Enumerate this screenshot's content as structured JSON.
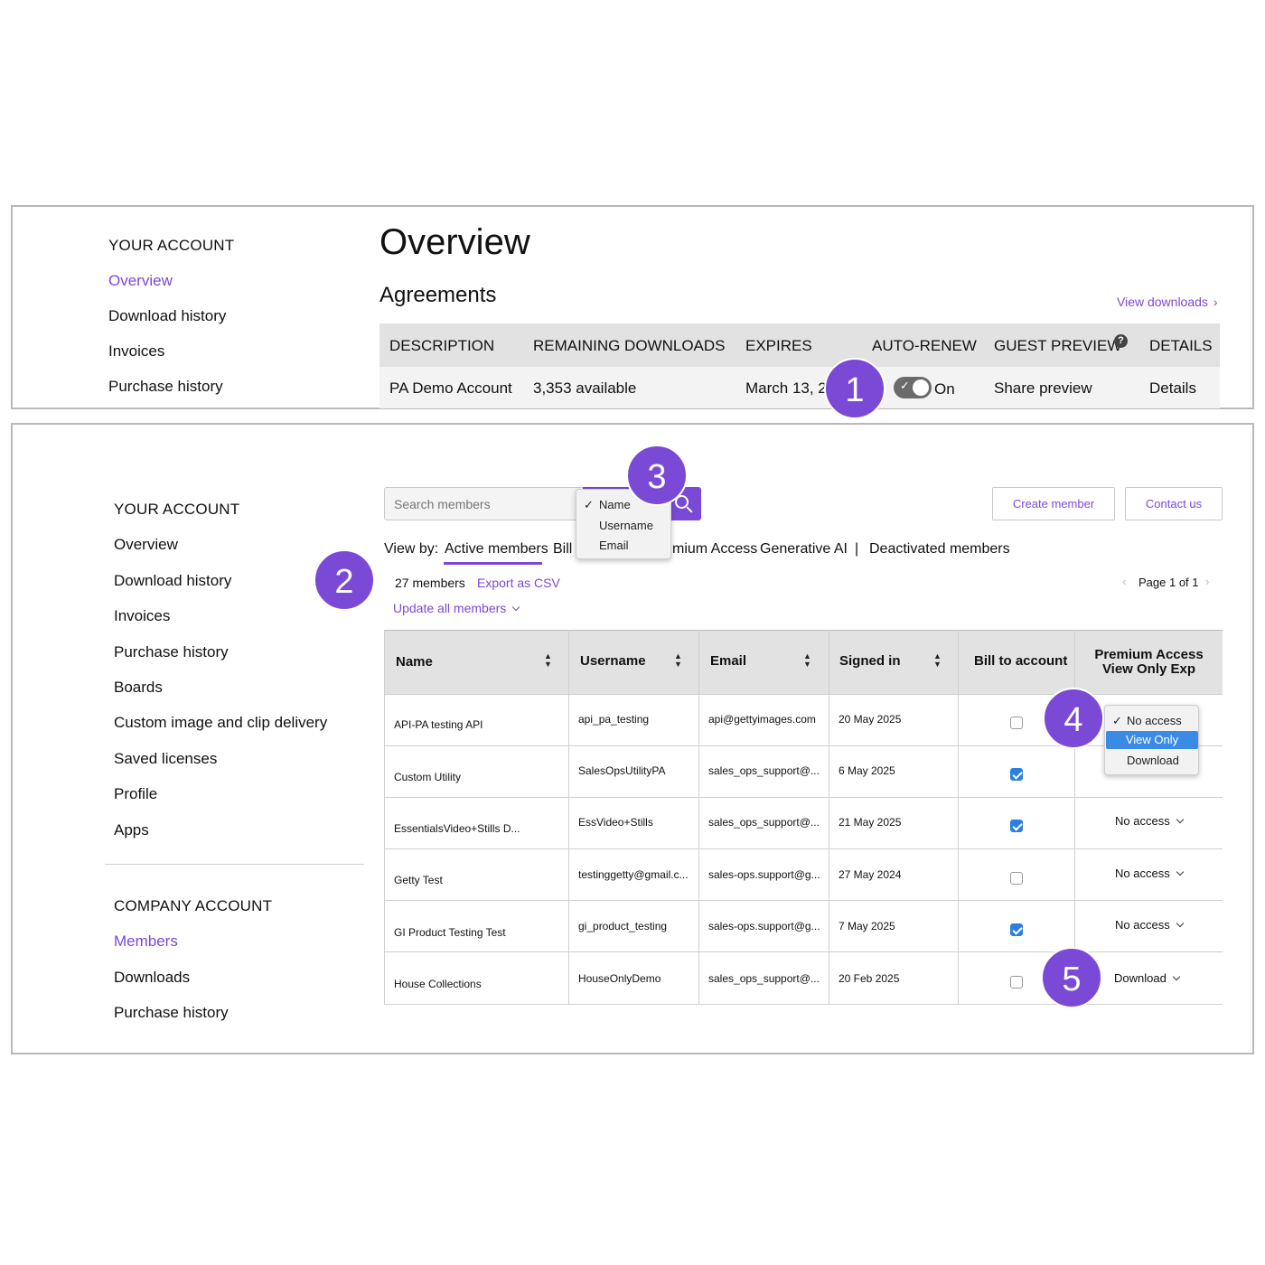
{
  "top": {
    "sidebar": {
      "heading": "YOUR ACCOUNT",
      "items": [
        "Overview",
        "Download history",
        "Invoices",
        "Purchase history"
      ]
    },
    "title": "Overview",
    "agreements_title": "Agreements",
    "view_downloads": "View downloads",
    "columns": [
      "DESCRIPTION",
      "REMAINING DOWNLOADS",
      "EXPIRES",
      "AUTO-RENEW",
      "GUEST PREVIEW",
      "DETAILS"
    ],
    "row": {
      "description": "PA Demo Account",
      "remaining": "3,353 available",
      "expires": "March 13, 2026",
      "autorenew": "On",
      "guest_preview": "Share preview",
      "details": "Details"
    }
  },
  "bottom": {
    "sidebar": {
      "heading": "YOUR ACCOUNT",
      "items": [
        "Overview",
        "Download history",
        "Invoices",
        "Purchase history",
        "Boards",
        "Custom image and clip delivery",
        "Saved licenses",
        "Profile",
        "Apps"
      ],
      "company_heading": "COMPANY ACCOUNT",
      "company_items": [
        "Members",
        "Downloads",
        "Purchase history"
      ]
    },
    "search": {
      "placeholder": "Search members",
      "dropdown": [
        "Name",
        "Username",
        "Email"
      ]
    },
    "create_member": "Create member",
    "contact_us": "Contact us",
    "view_by": {
      "label": "View by:",
      "tabs": [
        "Active members",
        "Bill",
        "mium Access",
        "Generative AI",
        "|",
        "Deactivated members"
      ]
    },
    "member_count": "27 members",
    "export_csv": "Export as CSV",
    "update_all": "Update all members",
    "pagination": "Page 1 of 1",
    "columns": [
      "Name",
      "Username",
      "Email",
      "Signed in",
      "Bill to account",
      "Premium Access",
      "View Only Exp"
    ],
    "rows": [
      {
        "name": "API-PA testing API",
        "username": "api_pa_testing",
        "email": "api@gettyimages.com",
        "signed": "20 May 2025",
        "bill": false,
        "access": ""
      },
      {
        "name": "Custom Utility",
        "username": "SalesOpsUtilityPA",
        "email": "sales_ops_support@...",
        "signed": "6 May 2025",
        "bill": true,
        "access": ""
      },
      {
        "name": "EssentialsVideo+Stills D...",
        "username": "EssVideo+Stills",
        "email": "sales_ops_support@...",
        "signed": "21 May 2025",
        "bill": true,
        "access": "No access"
      },
      {
        "name": "Getty Test",
        "username": "testinggetty@gmail.c...",
        "email": "sales-ops.support@g...",
        "signed": "27 May 2024",
        "bill": false,
        "access": "No access"
      },
      {
        "name": "GI Product Testing Test",
        "username": "gi_product_testing",
        "email": "sales-ops.support@g...",
        "signed": "7 May 2025",
        "bill": true,
        "access": "No access"
      },
      {
        "name": "House Collections",
        "username": "HouseOnlyDemo",
        "email": "sales_ops_support@...",
        "signed": "20 Feb 2025",
        "bill": false,
        "access": "Download"
      }
    ],
    "access_dropdown": [
      "No access",
      "View Only",
      "Download"
    ]
  },
  "badges": [
    "1",
    "2",
    "3",
    "4",
    "5"
  ],
  "colors": {
    "accent": "#7a49d6",
    "checkbox": "#2a7fe0",
    "selected": "#3b8be6"
  }
}
